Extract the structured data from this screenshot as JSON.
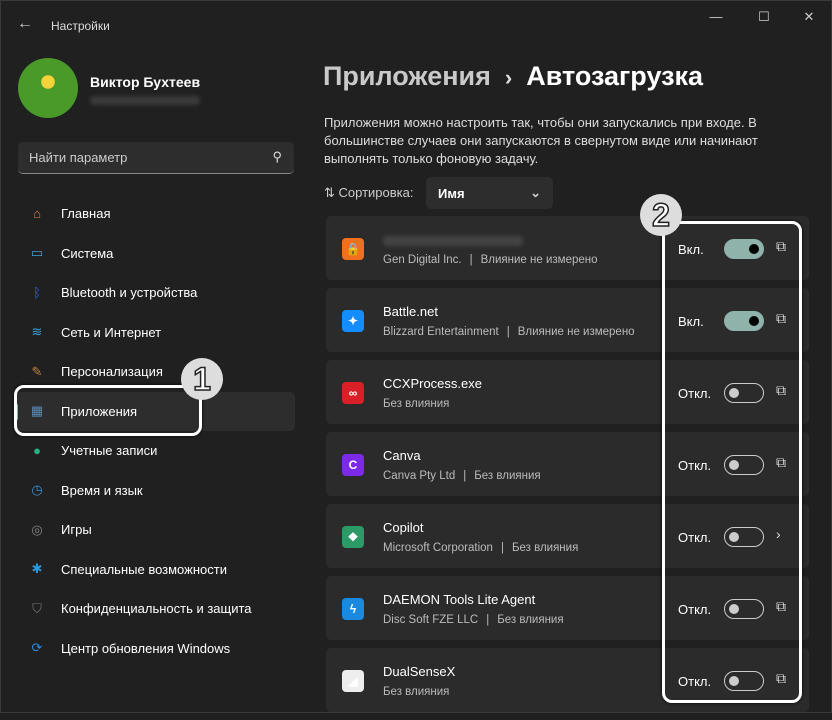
{
  "window": {
    "title": "Настройки"
  },
  "profile": {
    "name": "Виктор Бухтеев"
  },
  "search": {
    "placeholder": "Найти параметр"
  },
  "nav": [
    {
      "label": "Главная",
      "icon": "home-icon",
      "color": "#e07a4a",
      "glyph": "⌂"
    },
    {
      "label": "Система",
      "icon": "system-icon",
      "color": "#3aa0e0",
      "glyph": "▭"
    },
    {
      "label": "Bluetooth и устройства",
      "icon": "bluetooth-icon",
      "color": "#1a73e8",
      "glyph": "ᛒ"
    },
    {
      "label": "Сеть и Интернет",
      "icon": "wifi-icon",
      "color": "#3aa0e0",
      "glyph": "≋"
    },
    {
      "label": "Персонализация",
      "icon": "brush-icon",
      "color": "#c08040",
      "glyph": "✎"
    },
    {
      "label": "Приложения",
      "icon": "apps-icon",
      "color": "#5a8ab8",
      "glyph": "▦",
      "active": true
    },
    {
      "label": "Учетные записи",
      "icon": "account-icon",
      "color": "#2ab080",
      "glyph": "●"
    },
    {
      "label": "Время и язык",
      "icon": "time-language-icon",
      "color": "#3a90d0",
      "glyph": "◷"
    },
    {
      "label": "Игры",
      "icon": "gaming-icon",
      "color": "#888",
      "glyph": "◎"
    },
    {
      "label": "Специальные возможности",
      "icon": "accessibility-icon",
      "color": "#2a9ae0",
      "glyph": "✱"
    },
    {
      "label": "Конфиденциальность и защита",
      "icon": "shield-icon",
      "color": "#777",
      "glyph": "⛉"
    },
    {
      "label": "Центр обновления Windows",
      "icon": "update-icon",
      "color": "#2a8ae0",
      "glyph": "⟳"
    }
  ],
  "breadcrumb": {
    "parent": "Приложения",
    "sep": "›",
    "current": "Автозагрузка"
  },
  "description": "Приложения можно настроить так, чтобы они запускались при входе. В большинстве случаев они запускаются в свернутом виде или начинают выполнять только фоновую задачу.",
  "sort": {
    "label": "⇅ Сортировка:",
    "value": "Имя"
  },
  "apps": [
    {
      "name": "",
      "publisher": "Gen Digital Inc.",
      "impact": "Влияние не измерено",
      "state": "Вкл.",
      "on": true,
      "icon": "vpn-lock-icon",
      "color": "#f07020",
      "glyph": "🔒",
      "action": "⧉"
    },
    {
      "name": "Battle.net",
      "publisher": "Blizzard Entertainment",
      "impact": "Влияние не измерено",
      "state": "Вкл.",
      "on": true,
      "icon": "battlenet-icon",
      "color": "#148eff",
      "glyph": "✦",
      "action": "⧉"
    },
    {
      "name": "CCXProcess.exe",
      "publisher": "",
      "impact": "Без влияния",
      "state": "Откл.",
      "on": false,
      "icon": "adobe-cc-icon",
      "color": "#da1f26",
      "glyph": "∞",
      "action": "⧉"
    },
    {
      "name": "Canva",
      "publisher": "Canva Pty Ltd",
      "impact": "Без влияния",
      "state": "Откл.",
      "on": false,
      "icon": "canva-icon",
      "color": "#7d2ae8",
      "glyph": "C",
      "action": "⧉"
    },
    {
      "name": "Copilot",
      "publisher": "Microsoft Corporation",
      "impact": "Без влияния",
      "state": "Откл.",
      "on": false,
      "icon": "copilot-icon",
      "color": "#2b9a66",
      "glyph": "❖",
      "action": "›"
    },
    {
      "name": "DAEMON Tools Lite Agent",
      "publisher": "Disc Soft FZE LLC",
      "impact": "Без влияния",
      "state": "Откл.",
      "on": false,
      "icon": "daemon-tools-icon",
      "color": "#1a8ae0",
      "glyph": "ϟ",
      "action": "⧉"
    },
    {
      "name": "DualSenseX",
      "publisher": "",
      "impact": "Без влияния",
      "state": "Откл.",
      "on": false,
      "icon": "dualsensex-icon",
      "color": "#eeeeee",
      "glyph": "◢",
      "action": "⧉"
    }
  ],
  "annotations": [
    "1",
    "2"
  ]
}
